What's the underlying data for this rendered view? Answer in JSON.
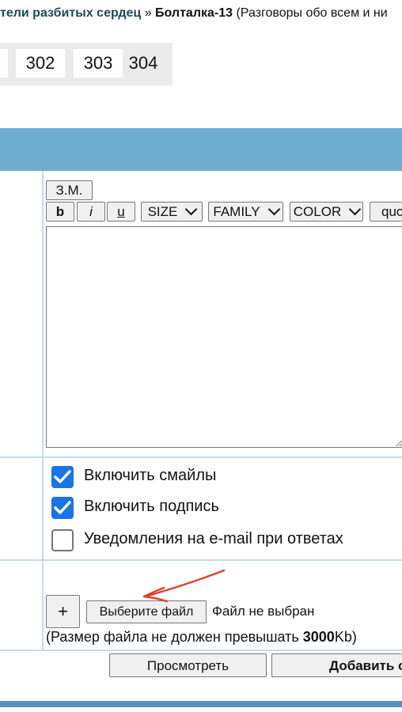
{
  "breadcrumb": {
    "parent_link": "тели разбитых сердец",
    "separator": "»",
    "current": "Болталка-13",
    "description": "(Разговоры обо всем и ни"
  },
  "pagination": {
    "pages": [
      "302",
      "303",
      "304"
    ],
    "current": "304"
  },
  "editor": {
    "zm_label": "З.М.",
    "bold_label": "b",
    "italic_label": "i",
    "underline_label": "u",
    "size_label": "SIZE",
    "family_label": "FAMILY",
    "color_label": "COLOR",
    "quote_label": "quo",
    "text_value": ""
  },
  "options": [
    {
      "label": "Включить смайлы",
      "checked": true
    },
    {
      "label": "Включить подпись",
      "checked": true
    },
    {
      "label": "Уведомления на e-mail при ответах",
      "checked": false
    }
  ],
  "attachment": {
    "add_label": "+",
    "choose_file_label": "Выберите файл",
    "no_file_text": "Файл не выбран",
    "size_note_prefix": "(Размер файла не должен превышать ",
    "size_note_value": "3000",
    "size_note_suffix": "Kb)"
  },
  "actions": {
    "preview_label": "Просмотреть",
    "submit_label": "Добавить о"
  },
  "colors": {
    "header_bar": "#6fadcf",
    "link": "#1c4a5a",
    "checkbox": "#1a73e8",
    "annotation": "#e0402a"
  }
}
